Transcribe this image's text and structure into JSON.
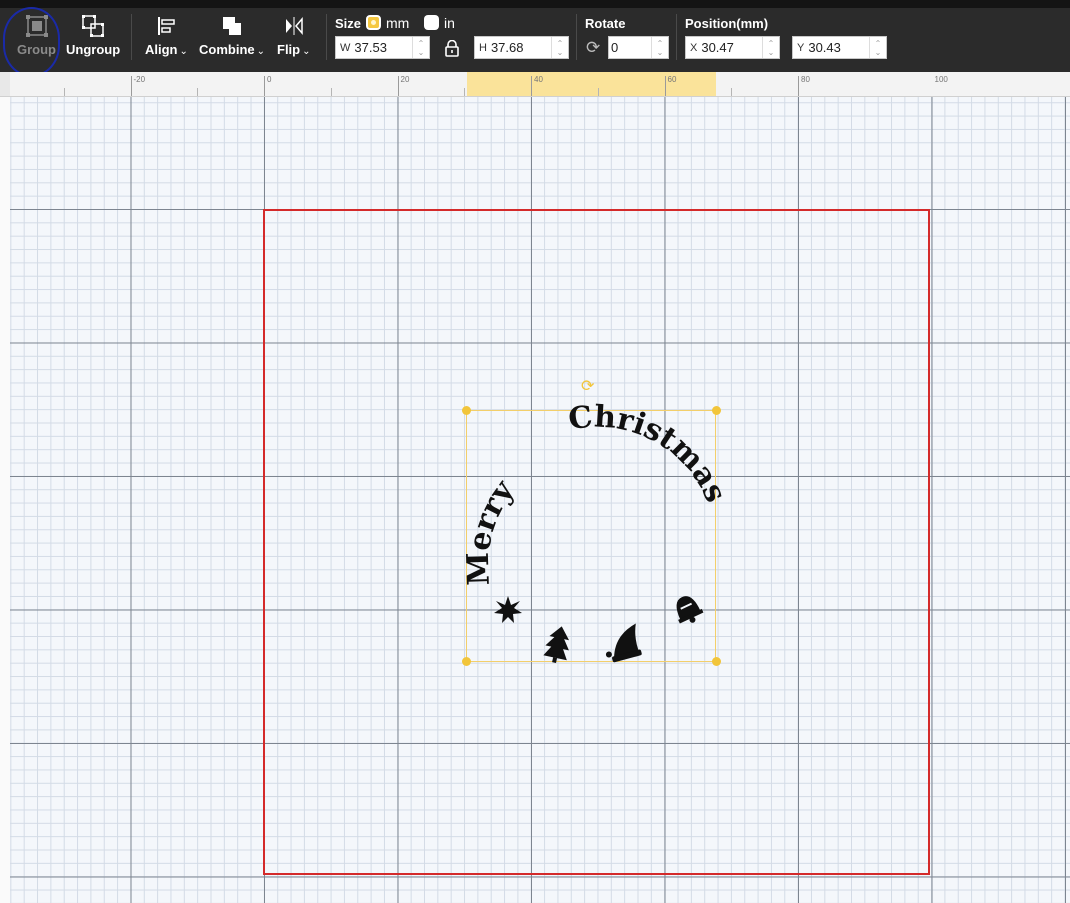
{
  "toolbar": {
    "group_label": "Group",
    "ungroup_label": "Ungroup",
    "align_label": "Align",
    "combine_label": "Combine",
    "flip_label": "Flip",
    "size_label": "Size",
    "unit_mm": "mm",
    "unit_in": "in",
    "unit_selected": "mm",
    "width_prefix": "W",
    "width_value": "37.53",
    "height_prefix": "H",
    "height_value": "37.68",
    "rotate_label": "Rotate",
    "rotate_value": "0",
    "position_label": "Position(mm)",
    "x_prefix": "X",
    "x_value": "30.47",
    "y_prefix": "Y",
    "y_value": "30.43"
  },
  "ruler": {
    "labels": [
      "-20",
      "0",
      "20",
      "40",
      "60",
      "80",
      "100"
    ]
  },
  "design": {
    "text_left": "Merry",
    "text_right": "Christmas",
    "icons": [
      "star-icon",
      "tree-icon",
      "santa-hat-icon",
      "bell-icon"
    ]
  },
  "colors": {
    "toolbar_bg": "#2b2b2b",
    "selection": "#f2c53a",
    "work_area_border": "#d42a2a",
    "annotation_circle": "#1a2aa8"
  }
}
